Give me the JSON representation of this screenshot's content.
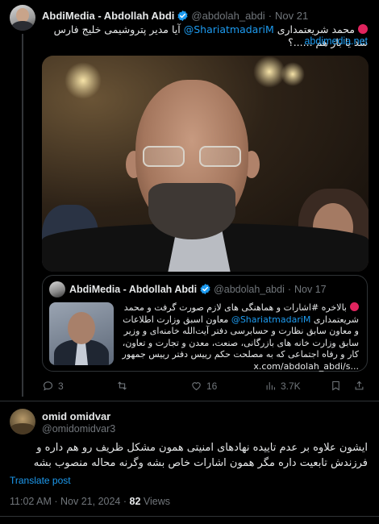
{
  "tweet": {
    "display_name": "AbdiMedia - Abdollah Abdi",
    "handle": "@abdolah_abdi",
    "date": "Nov 21",
    "text_prefix": "محمد شریعتمداری",
    "mention": "@ShariatmadariM",
    "text_suffix": "آیا مدیر پتروشیمی خلیج فارس شد یا باز هم ......؟",
    "link": "abdimedia.net",
    "image_icon": "portrait-photo"
  },
  "quote": {
    "display_name": "AbdiMedia - Abdollah Abdi",
    "handle": "@abdolah_abdi",
    "date": "Nov 17",
    "text_prefix": "بالاخره #اشارات و هماهنگی های لازم صورت گرفت و محمد شریعتمداری",
    "mention": "@ShariatmadariM",
    "text_body": "معاون اسبق وزارت اطلاعات و معاون سابق نظارت و حسابرسی دفتر آیت‌الله خامنه‌ای و وزیر سابق وزارت خانه های بازرگانی، صنعت، معدن و تجارت و تعاون، کار و رفاه اجتماعی که به مصلحت حکم رییس دفتر رییس جمهور",
    "link": "x.com/abdolah_abdi/s...",
    "thumb_icon": "portrait-thumbnail"
  },
  "actions": {
    "replies": "3",
    "retweets": "",
    "likes": "16",
    "views": "3.7K"
  },
  "reply": {
    "display_name": "omid omidvar",
    "handle": "@omidomidvar3",
    "text": "ایشون علاوه بر عدم تاییده نهادهای امنیتی همون مشکل ظریف رو هم داره و فرزندش تابعیت داره مگر همون اشارات خاص بشه وگرنه محاله منصوب بشه",
    "translate": "Translate post",
    "time": "11:02 AM",
    "date": "Nov 21, 2024",
    "views_count": "82",
    "views_label": "Views"
  },
  "colors": {
    "background": "#000000",
    "text": "#e7e9ea",
    "muted": "#71767b",
    "accent": "#1d9bf0",
    "verified": "#1d9bf0",
    "divider": "#2f3336"
  }
}
